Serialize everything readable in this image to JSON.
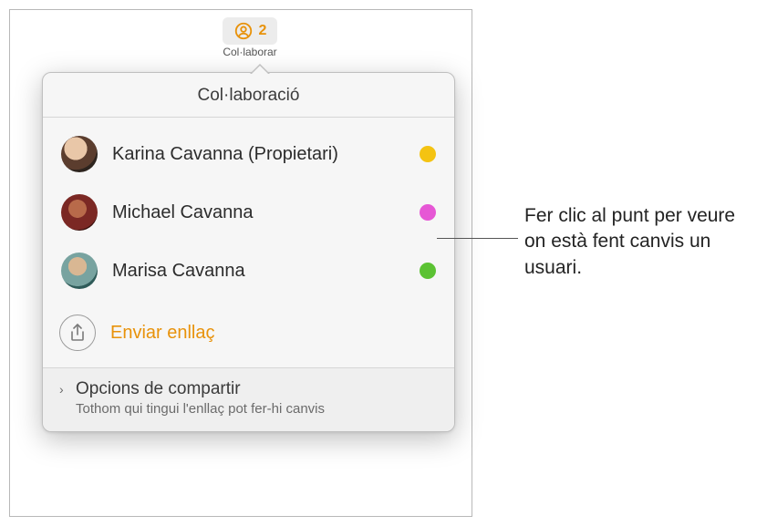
{
  "toolbar": {
    "collaborate_label": "Col·laborar",
    "count": "2"
  },
  "popover": {
    "title": "Col·laboració",
    "users": [
      {
        "name": "Karina Cavanna (Propietari)",
        "dot_color": "#f4c312"
      },
      {
        "name": "Michael Cavanna",
        "dot_color": "#e657d5"
      },
      {
        "name": "Marisa Cavanna",
        "dot_color": "#5bc233"
      }
    ],
    "share_link_label": "Enviar enllaç",
    "options": {
      "title": "Opcions de compartir",
      "subtitle": "Tothom qui tingui l'enllaç pot fer-hi canvis",
      "chevron": "›"
    }
  },
  "callout": "Fer clic al punt per veure on està fent canvis un usuari."
}
